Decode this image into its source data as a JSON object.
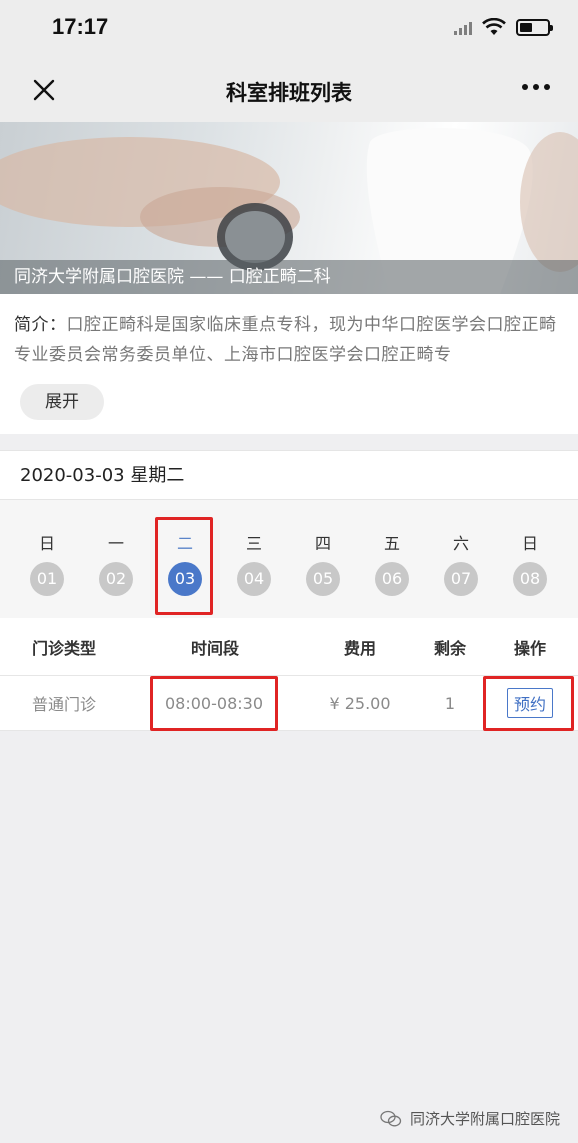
{
  "status_bar": {
    "time": "17:17"
  },
  "nav": {
    "title": "科室排班列表"
  },
  "banner": {
    "caption": "同济大学附属口腔医院 —— 口腔正畸二科"
  },
  "intro": {
    "label": "简介：",
    "text": "口腔正畸科是国家临床重点专科，现为中华口腔医学会口腔正畸专业委员会常务委员单位、上海市口腔医学会口腔正畸专",
    "expand_label": "展开"
  },
  "date": {
    "label": "2020-03-03 星期二"
  },
  "days": [
    {
      "week": "日",
      "num": "01"
    },
    {
      "week": "一",
      "num": "02"
    },
    {
      "week": "二",
      "num": "03"
    },
    {
      "week": "三",
      "num": "04"
    },
    {
      "week": "四",
      "num": "05"
    },
    {
      "week": "五",
      "num": "06"
    },
    {
      "week": "六",
      "num": "07"
    },
    {
      "week": "日",
      "num": "08"
    }
  ],
  "selected_day": "03",
  "table": {
    "headers": [
      "门诊类型",
      "时间段",
      "费用",
      "剩余",
      "操作"
    ],
    "rows": [
      {
        "type": "普通门诊",
        "time": "08:00-08:30",
        "fee": "¥ 25.00",
        "remaining": "1",
        "action": "预约"
      }
    ]
  },
  "watermark": {
    "text": "同济大学附属口腔医院"
  },
  "colors": {
    "accent": "#4a78c9",
    "highlight": "#e02424"
  }
}
